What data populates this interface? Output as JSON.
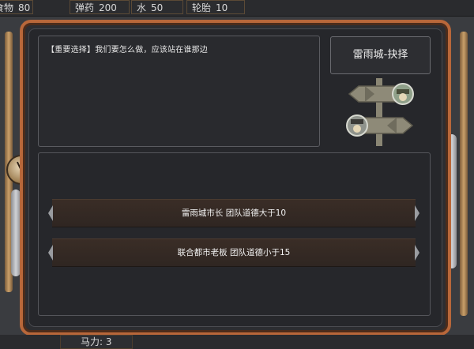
{
  "resources": [
    {
      "label": "食物",
      "value": "80"
    },
    {
      "label": "弹药",
      "value": "200"
    },
    {
      "label": "水",
      "value": "50"
    },
    {
      "label": "轮胎",
      "value": "10"
    }
  ],
  "dialog": {
    "question": "【重要选择】我们要怎么做，应该站在谁那边",
    "title": "雷雨城-抉择"
  },
  "options": [
    {
      "text": "雷雨城市长   团队道德大于10"
    },
    {
      "text": "联合都市老板   团队道德小于15"
    }
  ],
  "status": {
    "horsepower_label": "马力",
    "horsepower_value": "3"
  },
  "icons": {
    "signpost": "signpost-icon",
    "gauge": "pressure-gauge-icon",
    "person": "portrait-icon"
  },
  "colors": {
    "frame": "#b8673a",
    "panel": "#26272b",
    "option_bg": "#3a2d26"
  }
}
